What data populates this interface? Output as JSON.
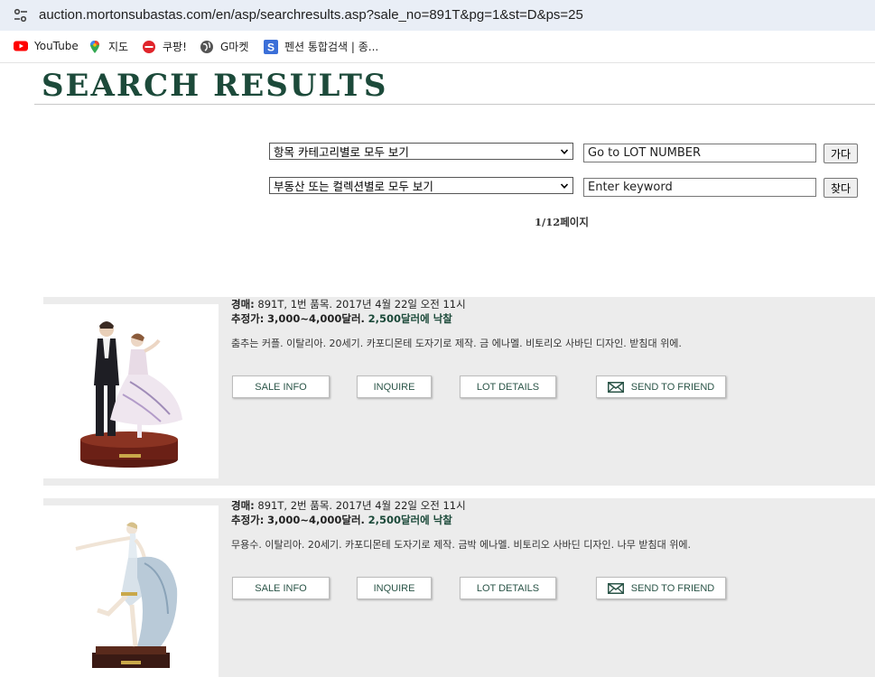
{
  "browser": {
    "url": "auction.mortonsubastas.com/en/asp/searchresults.asp?sale_no=891T&pg=1&st=D&ps=25",
    "bookmarks": [
      {
        "label": "YouTube",
        "icon": "youtube-icon"
      },
      {
        "label": "지도",
        "icon": "maps-pin-icon"
      },
      {
        "label": "쿠팡!",
        "icon": "coupang-icon"
      },
      {
        "label": "G마켓",
        "icon": "globe-icon"
      },
      {
        "label": "펜션 통합검색 | 종...",
        "icon": "s-logo-icon"
      }
    ]
  },
  "page": {
    "title": "SEARCH RESULTS"
  },
  "filters": {
    "category_select": "항목 카테고리별로 모두 보기",
    "collection_select": "부동산 또는 컬렉션별로 모두 보기",
    "lot_input_value": "Go to LOT NUMBER",
    "keyword_input_value": "Enter keyword",
    "go_button": "가다",
    "find_button": "찾다",
    "page_indicator": "1/12페이지"
  },
  "buttons": {
    "sale_info": "SALE INFO",
    "inquire": "INQUIRE",
    "lot_details": "LOT DETAILS",
    "send_to_friend": "SEND TO FRIEND"
  },
  "lots": [
    {
      "meta_label": "경매:",
      "meta": "891T, 1번 품목.  2017년 4월 22일 오전 11시",
      "estimate_label": "추정가:",
      "estimate": "3,000~4,000달러.",
      "sold": "2,500달러에 낙찰",
      "description": "춤추는 커플. 이탈리아. 20세기. 카포디몬테 도자기로 제작. 금 에나멜. 비토리오 사바딘 디자인. 받침대 위에."
    },
    {
      "meta_label": "경매:",
      "meta": "891T, 2번 품목.  2017년 4월 22일 오전 11시",
      "estimate_label": "추정가:",
      "estimate": "3,000~4,000달러.",
      "sold": "2,500달러에 낙찰",
      "description": "무용수. 이탈리아. 20세기. 카포디몬테 도자기로 제작. 금박 에나멜. 비토리오 사바딘 디자인. 나무 받침대 위에."
    }
  ],
  "colors": {
    "brand_green": "#1c4a3a",
    "lot_background": "#ececec",
    "addressbar": "#e9eef6"
  }
}
